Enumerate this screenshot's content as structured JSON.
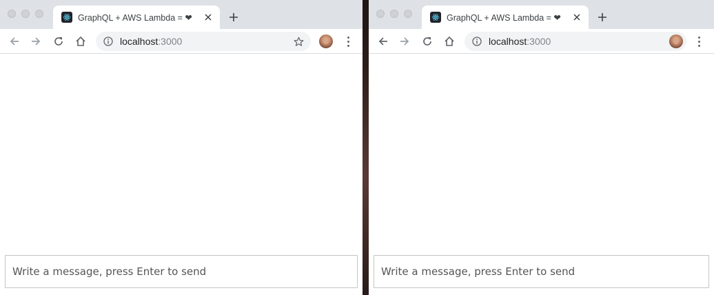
{
  "windows": [
    {
      "tab": {
        "title": "GraphQL + AWS Lambda = ❤"
      },
      "address": {
        "host": "localhost",
        "port": ":3000"
      },
      "message_input": {
        "placeholder": "Write a message, press Enter to send",
        "value": ""
      }
    },
    {
      "tab": {
        "title": "GraphQL + AWS Lambda = ❤"
      },
      "address": {
        "host": "localhost",
        "port": ":3000"
      },
      "message_input": {
        "placeholder": "Write a message, press Enter to send",
        "value": ""
      }
    }
  ],
  "icons": {
    "back": "arrow-back-icon",
    "forward": "arrow-forward-icon",
    "reload": "reload-icon",
    "home": "home-icon",
    "info": "info-icon",
    "star": "star-icon",
    "menu": "kebab-menu-icon",
    "close": "close-icon",
    "new_tab": "plus-icon",
    "favicon": "react-logo-icon"
  },
  "colors": {
    "tabstrip": "#dee1e6",
    "omnibox": "#f1f3f4",
    "text": "#202124",
    "port": "#80868b"
  }
}
